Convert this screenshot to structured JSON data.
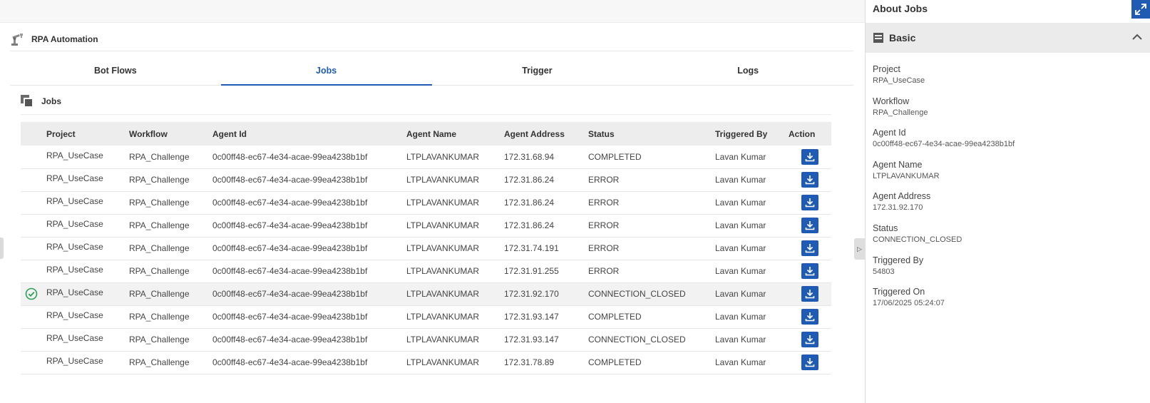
{
  "app": {
    "title": "RPA Automation"
  },
  "tabs": [
    {
      "label": "Bot Flows",
      "active": false
    },
    {
      "label": "Jobs",
      "active": true
    },
    {
      "label": "Trigger",
      "active": false
    },
    {
      "label": "Logs",
      "active": false
    }
  ],
  "section": {
    "title": "Jobs"
  },
  "table": {
    "columns": [
      "Project",
      "Workflow",
      "Agent Id",
      "Agent Name",
      "Agent Address",
      "Status",
      "Triggered By",
      "Action"
    ],
    "rows": [
      {
        "project": "RPA_UseCase",
        "workflow": "RPA_Challenge",
        "agent_id": "0c00ff48-ec67-4e34-acae-99ea4238b1bf",
        "agent_name": "LTPLAVANKUMAR",
        "agent_address": "172.31.68.94",
        "status": "COMPLETED",
        "triggered_by": "Lavan Kumar"
      },
      {
        "project": "RPA_UseCase",
        "workflow": "RPA_Challenge",
        "agent_id": "0c00ff48-ec67-4e34-acae-99ea4238b1bf",
        "agent_name": "LTPLAVANKUMAR",
        "agent_address": "172.31.86.24",
        "status": "ERROR",
        "triggered_by": "Lavan Kumar"
      },
      {
        "project": "RPA_UseCase",
        "workflow": "RPA_Challenge",
        "agent_id": "0c00ff48-ec67-4e34-acae-99ea4238b1bf",
        "agent_name": "LTPLAVANKUMAR",
        "agent_address": "172.31.86.24",
        "status": "ERROR",
        "triggered_by": "Lavan Kumar"
      },
      {
        "project": "RPA_UseCase",
        "workflow": "RPA_Challenge",
        "agent_id": "0c00ff48-ec67-4e34-acae-99ea4238b1bf",
        "agent_name": "LTPLAVANKUMAR",
        "agent_address": "172.31.86.24",
        "status": "ERROR",
        "triggered_by": "Lavan Kumar"
      },
      {
        "project": "RPA_UseCase",
        "workflow": "RPA_Challenge",
        "agent_id": "0c00ff48-ec67-4e34-acae-99ea4238b1bf",
        "agent_name": "LTPLAVANKUMAR",
        "agent_address": "172.31.74.191",
        "status": "ERROR",
        "triggered_by": "Lavan Kumar"
      },
      {
        "project": "RPA_UseCase",
        "workflow": "RPA_Challenge",
        "agent_id": "0c00ff48-ec67-4e34-acae-99ea4238b1bf",
        "agent_name": "LTPLAVANKUMAR",
        "agent_address": "172.31.91.255",
        "status": "ERROR",
        "triggered_by": "Lavan Kumar"
      },
      {
        "project": "RPA_UseCase",
        "workflow": "RPA_Challenge",
        "agent_id": "0c00ff48-ec67-4e34-acae-99ea4238b1bf",
        "agent_name": "LTPLAVANKUMAR",
        "agent_address": "172.31.92.170",
        "status": "CONNECTION_CLOSED",
        "triggered_by": "Lavan Kumar",
        "selected": true
      },
      {
        "project": "RPA_UseCase",
        "workflow": "RPA_Challenge",
        "agent_id": "0c00ff48-ec67-4e34-acae-99ea4238b1bf",
        "agent_name": "LTPLAVANKUMAR",
        "agent_address": "172.31.93.147",
        "status": "COMPLETED",
        "triggered_by": "Lavan Kumar"
      },
      {
        "project": "RPA_UseCase",
        "workflow": "RPA_Challenge",
        "agent_id": "0c00ff48-ec67-4e34-acae-99ea4238b1bf",
        "agent_name": "LTPLAVANKUMAR",
        "agent_address": "172.31.93.147",
        "status": "CONNECTION_CLOSED",
        "triggered_by": "Lavan Kumar"
      },
      {
        "project": "RPA_UseCase",
        "workflow": "RPA_Challenge",
        "agent_id": "0c00ff48-ec67-4e34-acae-99ea4238b1bf",
        "agent_name": "LTPLAVANKUMAR",
        "agent_address": "172.31.78.89",
        "status": "COMPLETED",
        "triggered_by": "Lavan Kumar"
      }
    ],
    "action_icon": "download-icon",
    "selected_icon": "check-circle-icon"
  },
  "side_panel": {
    "title": "About Jobs",
    "section_label": "Basic",
    "fields": [
      {
        "label": "Project",
        "value": "RPA_UseCase"
      },
      {
        "label": "Workflow",
        "value": "RPA_Challenge"
      },
      {
        "label": "Agent Id",
        "value": "0c00ff48-ec67-4e34-acae-99ea4238b1bf"
      },
      {
        "label": "Agent Name",
        "value": "LTPLAVANKUMAR"
      },
      {
        "label": "Agent Address",
        "value": "172.31.92.170"
      },
      {
        "label": "Status",
        "value": "CONNECTION_CLOSED"
      },
      {
        "label": "Triggered By",
        "value": "54803"
      },
      {
        "label": "Triggered On",
        "value": "17/06/2025 05:24:07"
      }
    ]
  },
  "colors": {
    "accent": "#1e5bb5",
    "button": "#1f5ab3",
    "success": "#2e9e5b",
    "header_bg": "#ededed"
  }
}
